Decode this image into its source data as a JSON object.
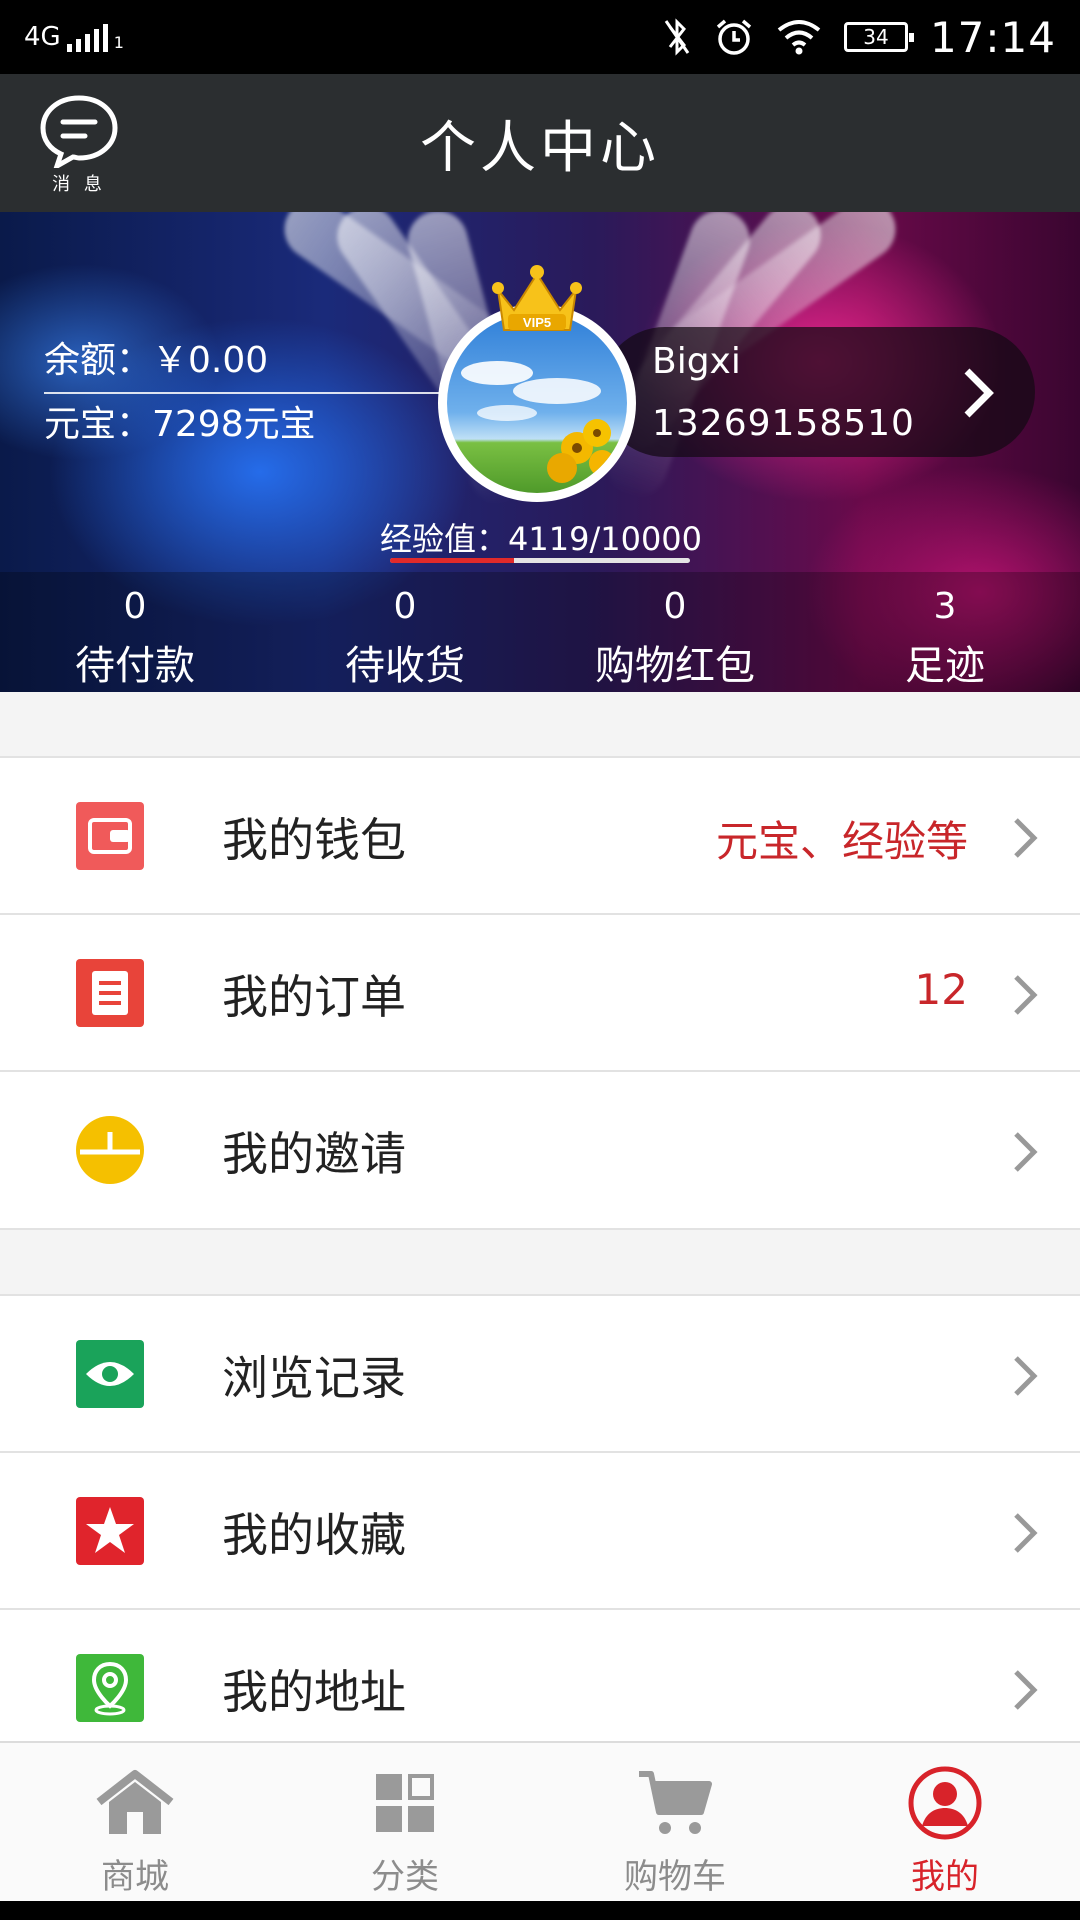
{
  "status_bar": {
    "network": "4G",
    "sim": "1",
    "battery": "34",
    "time": "17:14"
  },
  "header": {
    "title": "个人中心",
    "message_label": "消 息"
  },
  "profile": {
    "balance_text": "余额：￥0.00",
    "yuanbao_text": "元宝：7298元宝",
    "username": "Bigxi",
    "phone": "13269158510",
    "vip_badge": "VIP5",
    "exp_text": "经验值：4119/10000",
    "exp_progress": 0.4119
  },
  "stats": [
    {
      "value": "0",
      "label": "待付款"
    },
    {
      "value": "0",
      "label": "待收货"
    },
    {
      "value": "0",
      "label": "购物红包"
    },
    {
      "value": "3",
      "label": "足迹"
    }
  ],
  "menu_group_1": [
    {
      "label": "我的钱包",
      "hint": "元宝、经验等",
      "icon": "wallet-icon",
      "color": "#f05a5a"
    },
    {
      "label": "我的订单",
      "hint": "12",
      "icon": "order-icon",
      "color": "#e8443a"
    },
    {
      "label": "我的邀请",
      "hint": "",
      "icon": "invite-icon",
      "color": "#f5c000"
    }
  ],
  "menu_group_2": [
    {
      "label": "浏览记录",
      "hint": "",
      "icon": "eye-icon",
      "color": "#1aa35a"
    },
    {
      "label": "我的收藏",
      "hint": "",
      "icon": "star-icon",
      "color": "#e0242c"
    },
    {
      "label": "我的地址",
      "hint": "",
      "icon": "location-icon",
      "color": "#3fb83a"
    }
  ],
  "bottom_nav": [
    {
      "label": "商城",
      "icon": "home-icon",
      "active": false
    },
    {
      "label": "分类",
      "icon": "category-icon",
      "active": false
    },
    {
      "label": "购物车",
      "icon": "cart-icon",
      "active": false
    },
    {
      "label": "我的",
      "icon": "profile-icon",
      "active": true
    }
  ],
  "colors": {
    "accent": "#d8232a",
    "header_bg": "#2b2e30",
    "hint_red": "#c8262a",
    "nav_inactive": "#8c8c8c"
  }
}
